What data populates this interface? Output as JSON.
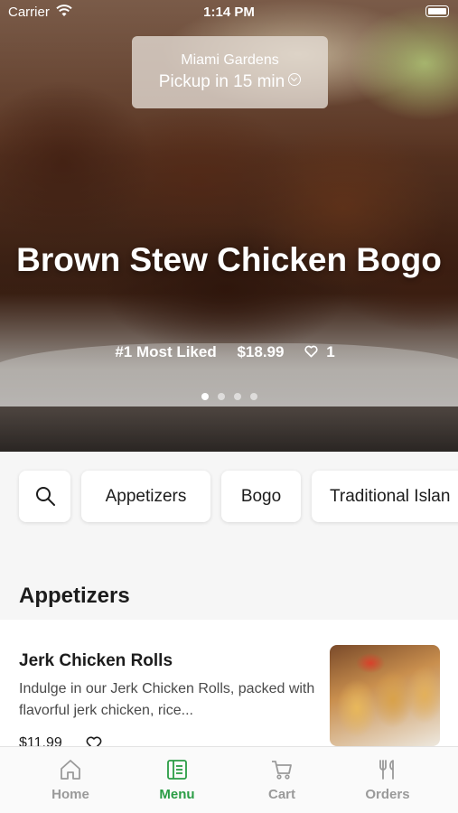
{
  "status_bar": {
    "carrier": "Carrier",
    "time": "1:14 PM"
  },
  "header": {
    "location": "Miami Gardens",
    "pickup": "Pickup in 15 min"
  },
  "featured": {
    "title": "Brown Stew Chicken Bogo",
    "badge": "#1 Most Liked",
    "price": "$18.99",
    "likes": "1",
    "carousel_total": 4,
    "carousel_active_index": 0
  },
  "categories": [
    "Appetizers",
    "Bogo",
    "Traditional Islan"
  ],
  "section": {
    "title": "Appetizers"
  },
  "items": [
    {
      "name": "Jerk Chicken Rolls",
      "description": "Indulge in our Jerk Chicken Rolls, packed with flavorful jerk chicken, rice...",
      "price": "$11.99"
    }
  ],
  "tab_bar": {
    "home": "Home",
    "menu": "Menu",
    "cart": "Cart",
    "orders": "Orders",
    "active": "menu",
    "active_color": "#2a9d45",
    "inactive_color": "#9a9a9a"
  }
}
